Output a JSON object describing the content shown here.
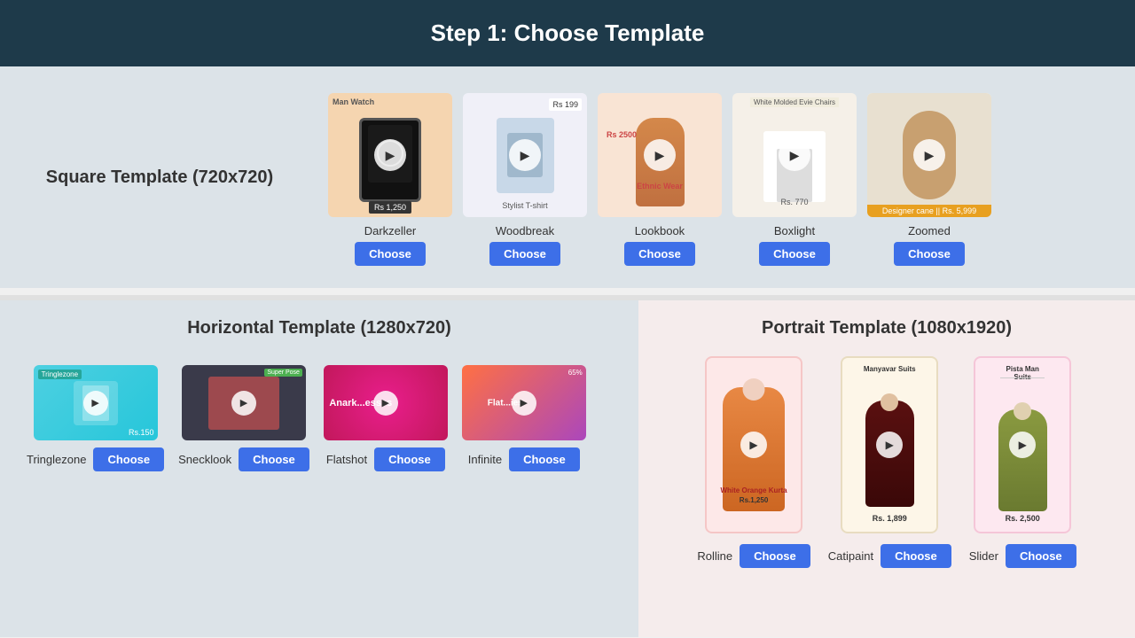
{
  "header": {
    "title": "Step 1: Choose Template"
  },
  "square_section": {
    "label": "Square Template (720x720)",
    "templates": [
      {
        "id": "darkzeller",
        "name": "Darkzeller",
        "price_bottom": "Rs 1,250",
        "label_top": "Man Watch",
        "thumb_style": "darkzeller"
      },
      {
        "id": "woodbreak",
        "name": "Woodbreak",
        "price_top_right": "Rs 199",
        "subtitle": "Stylist T-shirt",
        "thumb_style": "woodbreak"
      },
      {
        "id": "lookbook",
        "name": "Lookbook",
        "price": "Rs 2500",
        "label": "Ethnic Wear",
        "thumb_style": "lookbook"
      },
      {
        "id": "boxlight",
        "name": "Boxlight",
        "title_top": "White Molded Evie Chairs",
        "price_bottom": "Rs. 770",
        "thumb_style": "boxlight"
      },
      {
        "id": "zoomed",
        "name": "Zoomed",
        "price_bar": "Designer cane || Rs. 5,999",
        "thumb_style": "zoomed"
      }
    ]
  },
  "horizontal_section": {
    "label": "Horizontal Template (1280x720)",
    "templates": [
      {
        "id": "tringlezone",
        "name": "Tringlezone",
        "thumb_style": "tringlezone"
      },
      {
        "id": "snecklook",
        "name": "Snecklook",
        "thumb_style": "snecklook"
      },
      {
        "id": "flatshot",
        "name": "Flatshot",
        "thumb_style": "flatshot"
      },
      {
        "id": "infinite",
        "name": "Infinite",
        "thumb_style": "infinite"
      }
    ]
  },
  "portrait_section": {
    "label": "Portrait Template (1080x1920)",
    "templates": [
      {
        "id": "rolline",
        "name": "Rolline",
        "product_name": "White Orange Kurta",
        "price": "Rs.1,250",
        "thumb_style": "rolline"
      },
      {
        "id": "catipaint",
        "name": "Catipaint",
        "product_name": "Manyavar Suits",
        "price": "Rs. 1,899",
        "thumb_style": "catipaint"
      },
      {
        "id": "slider",
        "name": "Slider",
        "product_name": "Pista Man Suits",
        "price": "Rs. 2,500",
        "thumb_style": "slider"
      }
    ]
  },
  "buttons": {
    "choose_label": "Choose"
  }
}
